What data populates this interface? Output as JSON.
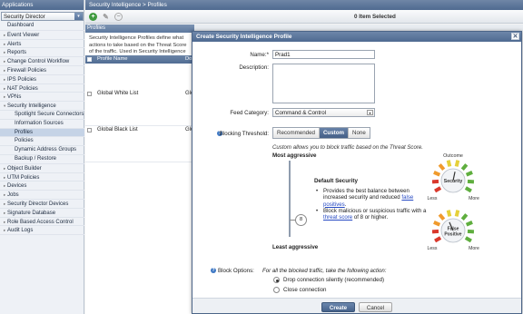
{
  "sidebar": {
    "header": "Applications",
    "selector": "Security Director",
    "items": [
      {
        "label": "Dashboard",
        "level": 0,
        "toggle": ""
      },
      {
        "label": "Event Viewer",
        "level": 0,
        "toggle": "▸"
      },
      {
        "label": "Alerts",
        "level": 0,
        "toggle": "▸"
      },
      {
        "label": "Reports",
        "level": 0,
        "toggle": "▸"
      },
      {
        "label": "Change Control Workflow",
        "level": 0,
        "toggle": "▸"
      },
      {
        "label": "Firewall Policies",
        "level": 0,
        "toggle": "▸"
      },
      {
        "label": "IPS Policies",
        "level": 0,
        "toggle": "▸"
      },
      {
        "label": "NAT Policies",
        "level": 0,
        "toggle": "▸"
      },
      {
        "label": "VPNs",
        "level": 0,
        "toggle": "▸"
      },
      {
        "label": "Security Intelligence",
        "level": 0,
        "toggle": "▾"
      },
      {
        "label": "Spotlight Secure Connectors",
        "level": 1,
        "toggle": ""
      },
      {
        "label": "Information Sources",
        "level": 1,
        "toggle": ""
      },
      {
        "label": "Profiles",
        "level": 1,
        "toggle": "",
        "selected": true
      },
      {
        "label": "Policies",
        "level": 1,
        "toggle": ""
      },
      {
        "label": "Dynamic Address Groups",
        "level": 1,
        "toggle": ""
      },
      {
        "label": "Backup / Restore",
        "level": 1,
        "toggle": ""
      },
      {
        "label": "Object Builder",
        "level": 0,
        "toggle": "▸"
      },
      {
        "label": "UTM Policies",
        "level": 0,
        "toggle": "▸"
      },
      {
        "label": "Devices",
        "level": 0,
        "toggle": "▸"
      },
      {
        "label": "Jobs",
        "level": 0,
        "toggle": "▸"
      },
      {
        "label": "Security Director Devices",
        "level": 0,
        "toggle": "▸"
      },
      {
        "label": "Signature Database",
        "level": 0,
        "toggle": "▸"
      },
      {
        "label": "Role Based Access Control",
        "level": 0,
        "toggle": "▸"
      },
      {
        "label": "Audit Logs",
        "level": 0,
        "toggle": "▸"
      }
    ]
  },
  "breadcrumb": "Security Intelligence > Profiles",
  "toolbar": {
    "add_icon": "+",
    "edit_icon": "✎",
    "delete_icon": "−",
    "selected_count": "0 Item Selected"
  },
  "profiles_panel": {
    "header": "Profiles",
    "description": "Security Intelligence Profiles define what actions to take based on the Threat Score of the traffic. Used in Security Intelligence Policies. Global white and black lists are automatically applied to all traffic.",
    "columns": [
      "Profile Name",
      "Do"
    ],
    "rows": [
      {
        "name": "Global White List",
        "desc": "Glo"
      },
      {
        "name": "Global Black List",
        "desc": "Glo"
      }
    ]
  },
  "modal": {
    "title": "Create Security Intelligence Profile",
    "close_icon": "✕",
    "name_label": "Name:*",
    "name_value": "Prad1",
    "description_label": "Description:",
    "description_value": "",
    "feed_label": "Feed Category:",
    "feed_value": "Command & Control",
    "feed_caret": "▾",
    "threshold_label": "Blocking Threshold:",
    "help_icon": "?",
    "threshold_options": [
      "Recommended",
      "Custom",
      "None"
    ],
    "threshold_selected": "Custom",
    "custom_note": "Custom allows you to block traffic based on the Threat Score.",
    "most_aggressive": "Most aggressive",
    "least_aggressive": "Least aggressive",
    "threat_score": 8,
    "default_security_title": "Default Security",
    "bullet1_pre": "Provides the best balance between increased security and reduced ",
    "bullet1_link": "false positives",
    "bullet1_post": ".",
    "bullet2_pre": "Block malicious or suspicious traffic with a ",
    "bullet2_link": "threat score",
    "bullet2_post": " of 8 or higher.",
    "gauges": [
      {
        "title": "Security",
        "top_label": "Outcome",
        "less": "Less",
        "more": "More",
        "level": 0.55
      },
      {
        "title": "False Positive",
        "top_label": "",
        "less": "Less",
        "more": "More",
        "level": 0.4
      }
    ],
    "block_options_label": "Block Options:",
    "block_options_note": "For all the blocked traffic, take the following action:",
    "radio_options": [
      {
        "label": "Drop connection silently (recommended)",
        "checked": true
      },
      {
        "label": "Close connection",
        "checked": false
      }
    ],
    "create_label": "Create",
    "cancel_label": "Cancel"
  },
  "colors": {
    "header_blue": "#4e6a91",
    "gauge_red": "#d9382c",
    "gauge_orange": "#f09a2c",
    "gauge_yellow": "#e5d03a",
    "gauge_green": "#5fae3e",
    "link": "#2549c3"
  }
}
